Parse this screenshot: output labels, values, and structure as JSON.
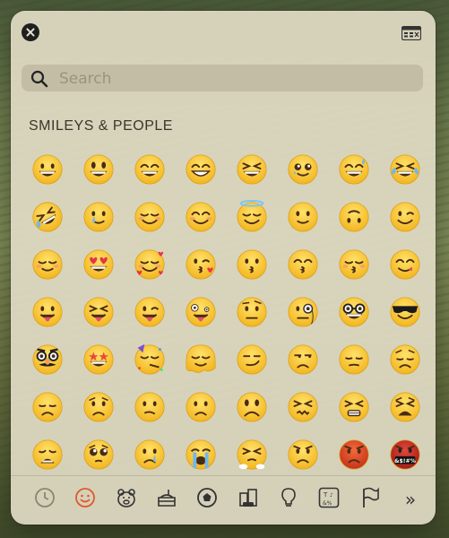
{
  "search": {
    "placeholder": "Search",
    "value": ""
  },
  "section": {
    "title": "SMILEYS & PEOPLE"
  },
  "emojis": [
    "grinning",
    "grinning-big-eyes",
    "grinning-smiling-eyes",
    "beaming",
    "squinting-laughing",
    "pleading-face",
    "grinning-sweat",
    "tears-of-joy",
    "rolling-laughing",
    "tear-face",
    "relaxed",
    "smiling-blush",
    "halo",
    "slightly-smiling",
    "upside-down",
    "winking",
    "relieved",
    "heart-eyes",
    "smiling-hearts",
    "kissing-heart",
    "kissing",
    "kissing-smiling-eyes",
    "kissing-closed-eyes",
    "yum",
    "tongue-out",
    "squinting-tongue",
    "winking-tongue",
    "zany",
    "raised-eyebrow",
    "monocle",
    "nerd",
    "sunglasses",
    "disguised",
    "star-struck",
    "partying",
    "melting",
    "smirk",
    "unamused",
    "dotted-line",
    "pensive",
    "sad-pensive",
    "worried",
    "confused",
    "slightly-frowning",
    "frowning",
    "confounded",
    "persevering",
    "tired",
    "weary",
    "pleading",
    "crying",
    "loudly-crying",
    "triumph",
    "angry",
    "pouting",
    "cursing"
  ],
  "categories": [
    {
      "name": "recent-icon"
    },
    {
      "name": "smileys-icon",
      "selected": true
    },
    {
      "name": "animals-icon"
    },
    {
      "name": "food-icon"
    },
    {
      "name": "activity-icon"
    },
    {
      "name": "travel-icon"
    },
    {
      "name": "objects-icon"
    },
    {
      "name": "symbols-icon"
    },
    {
      "name": "flags-icon"
    }
  ],
  "more": "»"
}
